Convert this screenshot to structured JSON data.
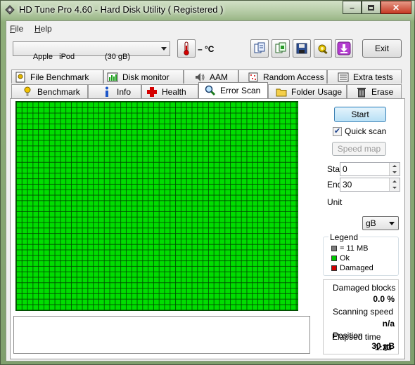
{
  "window": {
    "title": "HD Tune Pro 4.60 - Hard Disk Utility (  Registered )",
    "controls": [
      "minimize",
      "maximize",
      "close"
    ]
  },
  "menu": [
    {
      "label": "File",
      "accel": "F",
      "rest": "ile"
    },
    {
      "label": "Help",
      "accel": "H",
      "rest": "elp"
    }
  ],
  "toolbar": {
    "drive": "Apple   iPod              (30 gB)",
    "temperature": "– °C",
    "icons": [
      "thermometer-icon",
      "copy-text-icon",
      "copy-screenshot-icon",
      "save-icon",
      "options-icon",
      "download-icon"
    ],
    "exit_label": "Exit"
  },
  "tabs_top": [
    {
      "label": "File Benchmark",
      "icon": "file-benchmark-icon"
    },
    {
      "label": "Disk monitor",
      "icon": "disk-monitor-icon"
    },
    {
      "label": "AAM",
      "icon": "speaker-icon"
    },
    {
      "label": "Random Access",
      "icon": "random-access-icon"
    },
    {
      "label": "Extra tests",
      "icon": "extra-tests-icon"
    }
  ],
  "tabs_bottom": [
    {
      "label": "Benchmark",
      "icon": "benchmark-icon"
    },
    {
      "label": "Info",
      "icon": "info-icon"
    },
    {
      "label": "Health",
      "icon": "health-cross-icon"
    },
    {
      "label": "Error Scan",
      "icon": "magnifier-icon",
      "active": true
    },
    {
      "label": "Folder Usage",
      "icon": "folder-icon"
    },
    {
      "label": "Erase",
      "icon": "trash-icon"
    }
  ],
  "error_scan": {
    "start_label": "Start",
    "quick_scan_label": "Quick scan",
    "quick_scan_checked": true,
    "speed_map_label": "Speed map",
    "start_field_label": "Start",
    "start_value": "0",
    "end_field_label": "End",
    "end_value": "30",
    "unit_label": "Unit",
    "unit_value": "gB",
    "legend": {
      "title": "Legend",
      "items": [
        {
          "label": "= 11 MB",
          "color": "#7a7a7a"
        },
        {
          "label": "Ok",
          "color": "#00c800"
        },
        {
          "label": "Damaged",
          "color": "#d00000"
        }
      ]
    },
    "stats": {
      "damaged_blocks_label": "Damaged blocks",
      "damaged_blocks_value": "0.0 %",
      "scanning_speed_label": "Scanning speed",
      "scanning_speed_value": "n/a",
      "position_label": "Position",
      "position_value": "30 gB",
      "elapsed_time_label": "Elapsed time",
      "elapsed_time_value": "1:23"
    },
    "grid_color": "#00dd00",
    "grid_state": "all-ok"
  },
  "colors": {
    "ok": "#00dd00",
    "damaged": "#d00000",
    "accent": "#3c7fb1"
  }
}
